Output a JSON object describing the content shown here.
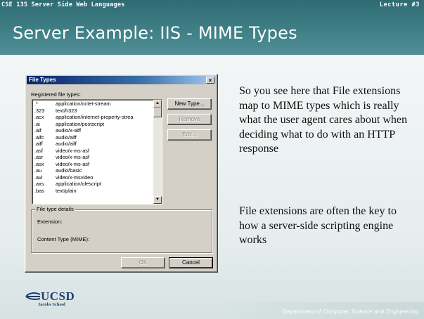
{
  "header": {
    "course": "CSE 135   Server Side Web Languages",
    "lecture": "Lecture #3",
    "title": "Server Example: IIS - MIME Types"
  },
  "dialog": {
    "title": "File Types",
    "close_glyph": "×",
    "registered_label": "Registered file types:",
    "file_types": [
      {
        "ext": ".*",
        "mime": "application/octet-stream"
      },
      {
        "ext": ".323",
        "mime": "text/h323"
      },
      {
        "ext": ".acx",
        "mime": "application/internet-property-strea"
      },
      {
        "ext": ".ai",
        "mime": "application/postscript"
      },
      {
        "ext": ".aif",
        "mime": "audio/x-aiff"
      },
      {
        "ext": ".aifc",
        "mime": "audio/aiff"
      },
      {
        "ext": ".aiff",
        "mime": "audio/aiff"
      },
      {
        "ext": ".asf",
        "mime": "video/x-ms-asf"
      },
      {
        "ext": ".asr",
        "mime": "video/x-ms-asf"
      },
      {
        "ext": ".asx",
        "mime": "video/x-ms-asf"
      },
      {
        "ext": ".au",
        "mime": "audio/basic"
      },
      {
        "ext": ".avi",
        "mime": "video/x-msvideo"
      },
      {
        "ext": ".axs",
        "mime": "application/olescript"
      },
      {
        "ext": ".bas",
        "mime": "text/plain"
      }
    ],
    "buttons": {
      "new_type": "New Type...",
      "remove": "Remove",
      "edit": "Edit...",
      "ok": "OK",
      "cancel": "Cancel"
    },
    "details": {
      "legend": "File type details",
      "extension_label": "Extension:",
      "content_type_label": "Content Type (MIME):"
    }
  },
  "body": {
    "paragraph1": "So you see here that File extensions map to MIME types which is really what the user agent cares about when deciding what to do with an HTTP response",
    "paragraph2": "File extensions are often the key to how a server-side scripting engine works"
  },
  "footer": {
    "logo_text": "UCSD",
    "logo_sub": "Jacobs School",
    "department": "Department of Computer Science and Engineering"
  },
  "colors": {
    "header": "#2f6b73",
    "dialog_title": "#0a246a",
    "dialog_face": "#d4d0c8",
    "logo": "#1f3f6e"
  }
}
